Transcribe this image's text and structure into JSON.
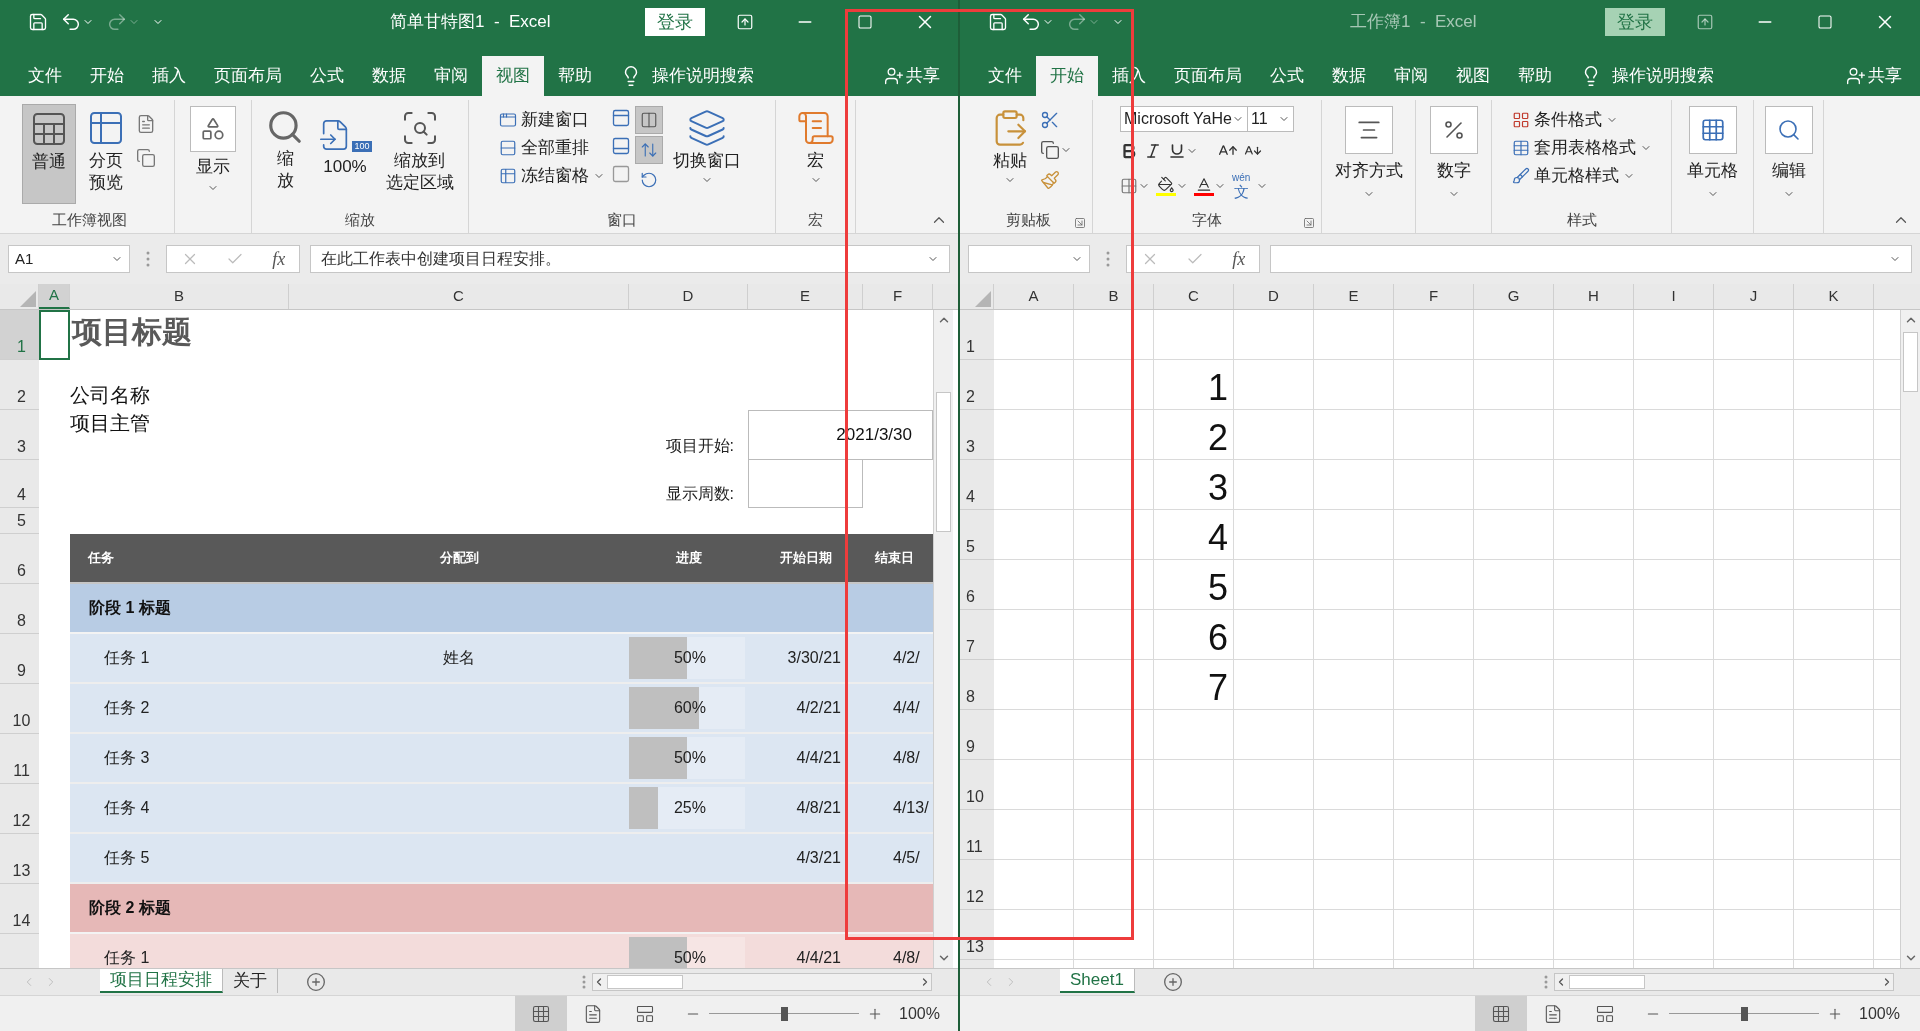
{
  "windows": [
    {
      "active": true,
      "title": "简单甘特图1  -  Excel",
      "login": "登录",
      "tabs": [
        {
          "label": "文件",
          "selected": false
        },
        {
          "label": "开始",
          "selected": false
        },
        {
          "label": "插入",
          "selected": false
        },
        {
          "label": "页面布局",
          "selected": false
        },
        {
          "label": "公式",
          "selected": false
        },
        {
          "label": "数据",
          "selected": false
        },
        {
          "label": "审阅",
          "selected": false
        },
        {
          "label": "视图",
          "selected": true
        },
        {
          "label": "帮助",
          "selected": false
        }
      ],
      "search": "操作说明搜索",
      "share": "共享",
      "ribbon": {
        "kind": "view",
        "workbook_views": {
          "label": "工作簿视图",
          "normal": {
            "label": "普通",
            "selected": true
          },
          "page_break": {
            "label": "分页预览",
            "selected": false
          }
        },
        "show": "显示",
        "zoom": {
          "label": "缩放",
          "zoom": "缩放",
          "hundred": "100%",
          "badge": "100",
          "to_selection": [
            "缩放到",
            "选定区域"
          ]
        },
        "window": {
          "label": "窗口",
          "new_window": "新建窗口",
          "arrange_all": "全部重排",
          "freeze": "冻结窗格",
          "switch": "切换窗口",
          "side_by_side": true,
          "sync_scroll": true
        },
        "macros": {
          "label": "宏",
          "button": "宏"
        }
      },
      "name_box": "A1",
      "fx": "fx",
      "formula": "在此工作表中创建项目日程安排。",
      "sheet": {
        "kind": "gantt",
        "columns": [
          {
            "label": "A",
            "selected": true
          },
          {
            "label": "B",
            "selected": false
          },
          {
            "label": "C",
            "selected": false
          },
          {
            "label": "D",
            "selected": false
          },
          {
            "label": "E",
            "selected": false
          },
          {
            "label": "F",
            "selected": false
          }
        ],
        "rows": [
          {
            "label": "1",
            "selected": true
          },
          {
            "label": "2",
            "selected": false
          },
          {
            "label": "3",
            "selected": false
          },
          {
            "label": "4",
            "selected": false
          },
          {
            "label": "5",
            "selected": false
          },
          {
            "label": "6",
            "selected": false
          },
          {
            "label": "8",
            "selected": false
          },
          {
            "label": "9",
            "selected": false
          },
          {
            "label": "10",
            "selected": false
          },
          {
            "label": "11",
            "selected": false
          },
          {
            "label": "12",
            "selected": false
          },
          {
            "label": "13",
            "selected": false
          },
          {
            "label": "14",
            "selected": false
          }
        ],
        "title": "项目标题",
        "company": "公司名称",
        "manager": "项目主管",
        "start_label": "项目开始:",
        "start_value": "2021/3/30",
        "weeks_label": "显示周数:",
        "headers": [
          "任务",
          "分配到",
          "进度",
          "开始日期",
          "结束日"
        ],
        "phases": [
          {
            "title": "阶段 1 标题",
            "color": "#b8cce4",
            "tasks": [
              {
                "name": "任务 1",
                "assignee": "姓名",
                "progress": "50%",
                "level": 0.5,
                "start": "3/30/21",
                "end": "4/2/"
              },
              {
                "name": "任务 2",
                "progress": "60%",
                "level": 0.6,
                "start": "4/2/21",
                "end": "4/4/"
              },
              {
                "name": "任务 3",
                "progress": "50%",
                "level": 0.5,
                "start": "4/4/21",
                "end": "4/8/"
              },
              {
                "name": "任务 4",
                "progress": "25%",
                "level": 0.25,
                "start": "4/8/21",
                "end": "4/13/"
              },
              {
                "name": "任务 5",
                "start": "4/3/21",
                "end": "4/5/"
              }
            ]
          },
          {
            "title": "阶段 2 标题",
            "color": "#e6b8b7",
            "tasks": [
              {
                "name": "任务 1",
                "progress": "50%",
                "level": 0.5,
                "start": "4/4/21",
                "end": "4/8/"
              }
            ]
          }
        ]
      },
      "sheet_tabs": [
        {
          "label": "项目日程安排",
          "selected": true
        },
        {
          "label": "关于",
          "selected": false
        }
      ],
      "views": [
        {
          "selected": true
        },
        {
          "selected": false
        },
        {
          "selected": false
        }
      ],
      "zoom": {
        "level": 0.5,
        "reading": "100%"
      }
    },
    {
      "active": false,
      "title": "工作簿1  -  Excel",
      "login": "登录",
      "tabs": [
        {
          "label": "文件",
          "selected": false
        },
        {
          "label": "开始",
          "selected": true
        },
        {
          "label": "插入",
          "selected": false
        },
        {
          "label": "页面布局",
          "selected": false
        },
        {
          "label": "公式",
          "selected": false
        },
        {
          "label": "数据",
          "selected": false
        },
        {
          "label": "审阅",
          "selected": false
        },
        {
          "label": "视图",
          "selected": false
        },
        {
          "label": "帮助",
          "selected": false
        }
      ],
      "search": "操作说明搜索",
      "share": "共享",
      "ribbon": {
        "kind": "home",
        "clipboard": {
          "label": "剪贴板",
          "paste": "粘贴"
        },
        "font": {
          "label": "字体",
          "name": "Microsoft YaHe",
          "size": "11",
          "phonetic_top": "wén",
          "phonetic_bottom": "文"
        },
        "alignment": "对齐方式",
        "number": "数字",
        "styles": {
          "label": "样式",
          "conditional": "条件格式",
          "table": "套用表格格式",
          "cell_styles": "单元格样式"
        },
        "cells": "单元格",
        "editing": "编辑"
      },
      "fx": "fx",
      "sheet": {
        "kind": "grid",
        "columns": [
          {
            "label": "A",
            "selected": false
          },
          {
            "label": "B",
            "selected": false
          },
          {
            "label": "C",
            "selected": false
          },
          {
            "label": "D",
            "selected": false
          },
          {
            "label": "E",
            "selected": false
          },
          {
            "label": "F",
            "selected": false
          },
          {
            "label": "G",
            "selected": false
          },
          {
            "label": "H",
            "selected": false
          },
          {
            "label": "I",
            "selected": false
          },
          {
            "label": "J",
            "selected": false
          },
          {
            "label": "K",
            "selected": false
          }
        ],
        "rows": [
          {
            "label": "1",
            "selected": false
          },
          {
            "label": "2",
            "selected": false
          },
          {
            "label": "3",
            "selected": false
          },
          {
            "label": "4",
            "selected": false
          },
          {
            "label": "5",
            "selected": false
          },
          {
            "label": "6",
            "selected": false
          },
          {
            "label": "7",
            "selected": false
          },
          {
            "label": "8",
            "selected": false
          },
          {
            "label": "9",
            "selected": false
          },
          {
            "label": "10",
            "selected": false
          },
          {
            "label": "11",
            "selected": false
          },
          {
            "label": "12",
            "selected": false
          },
          {
            "label": "13",
            "selected": false
          }
        ],
        "numbers": [
          "1",
          "2",
          "3",
          "4",
          "5",
          "6",
          "7"
        ]
      },
      "sheet_tabs": [
        {
          "label": "Sheet1",
          "selected": true
        }
      ],
      "views": [
        {
          "selected": true
        },
        {
          "selected": false
        },
        {
          "selected": false
        }
      ],
      "zoom": {
        "level": 0.5,
        "reading": "100%"
      }
    }
  ]
}
